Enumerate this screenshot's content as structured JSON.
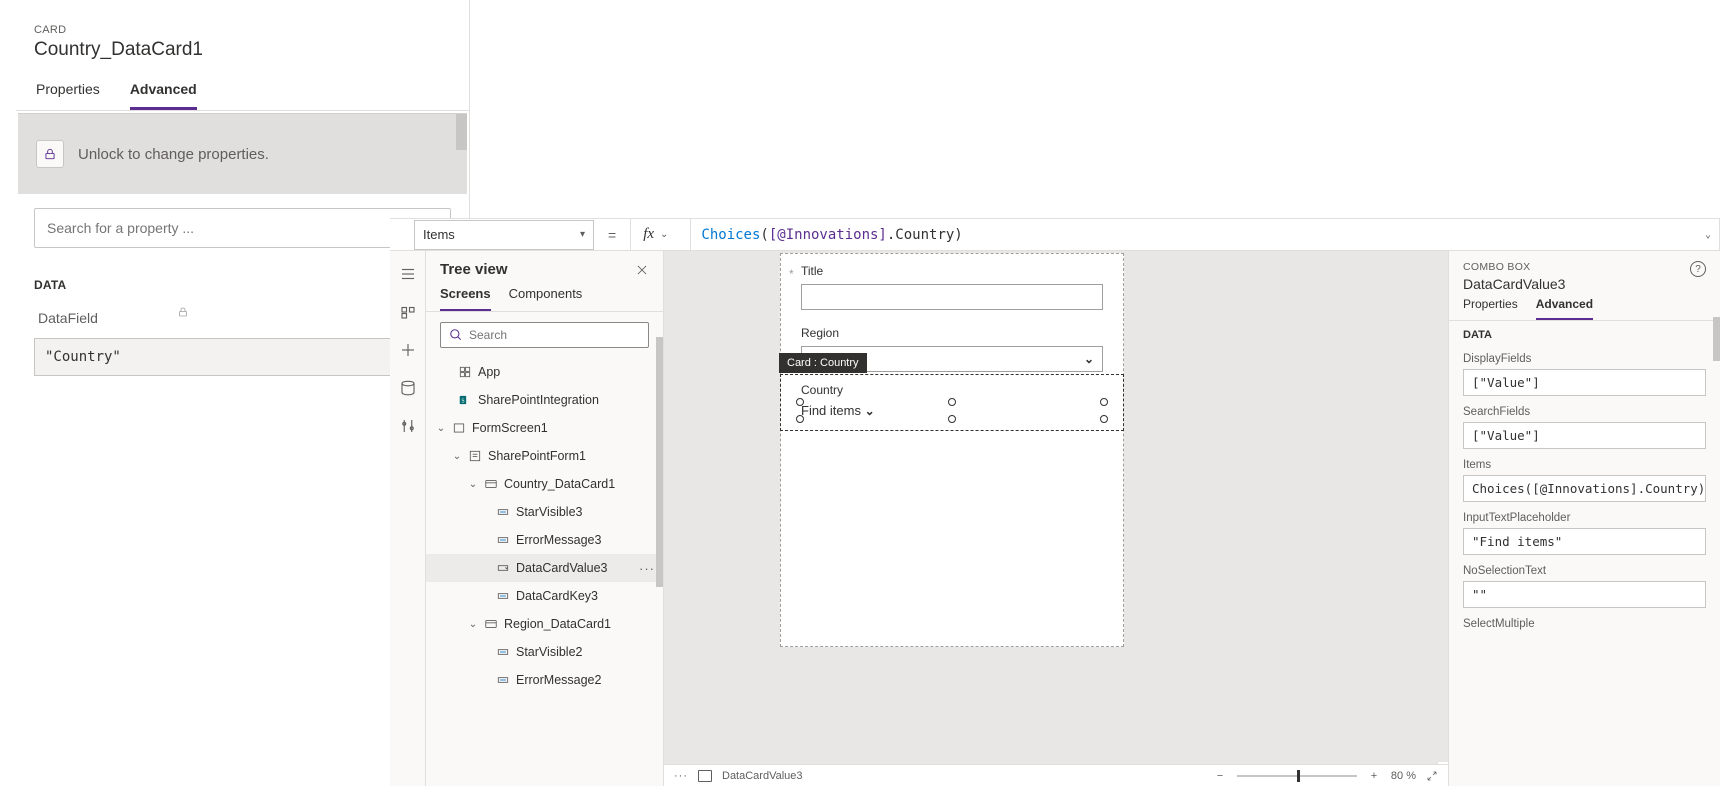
{
  "leftPanel": {
    "typeLabel": "CARD",
    "name": "Country_DataCard1",
    "tabs": {
      "properties": "Properties",
      "advanced": "Advanced"
    },
    "unlockMsg": "Unlock to change properties.",
    "searchPlaceholder": "Search for a property ...",
    "dataSection": "DATA",
    "dataFieldLabel": "DataField",
    "dataFieldValue": "\"Country\""
  },
  "formulaBar": {
    "property": "Items",
    "fx": "fx",
    "formula_fn": "Choices",
    "formula_open": "(",
    "formula_ds": "[@Innovations]",
    "formula_rest": ".Country)"
  },
  "treeView": {
    "title": "Tree view",
    "tabs": {
      "screens": "Screens",
      "components": "Components"
    },
    "searchPlaceholder": "Search",
    "nodes": {
      "app": "App",
      "sharepoint": "SharePointIntegration",
      "formscreen": "FormScreen1",
      "spform": "SharePointForm1",
      "countryCard": "Country_DataCard1",
      "starVisible3": "StarVisible3",
      "errorMessage3": "ErrorMessage3",
      "dataCardValue3": "DataCardValue3",
      "dataCardKey3": "DataCardKey3",
      "regionCard": "Region_DataCard1",
      "starVisible2": "StarVisible2",
      "errorMessage2": "ErrorMessage2"
    },
    "ellipsis": "···"
  },
  "canvas": {
    "titleLabel": "Title",
    "regionLabel": "Region",
    "countryLabel": "Country",
    "tooltip": "Card : Country",
    "findItems": "Find items",
    "breadcrumb": "DataCardValue3",
    "zoomMinus": "−",
    "zoomPlus": "+",
    "zoom": "80 %"
  },
  "rightPanel": {
    "typeLabel": "COMBO BOX",
    "name": "DataCardValue3",
    "tabs": {
      "properties": "Properties",
      "advanced": "Advanced"
    },
    "dataSection": "DATA",
    "displayFieldsLabel": "DisplayFields",
    "displayFieldsValue": "[\"Value\"]",
    "searchFieldsLabel": "SearchFields",
    "searchFieldsValue": "[\"Value\"]",
    "itemsLabel": "Items",
    "itemsValue": "Choices([@Innovations].Country)",
    "inputTextLabel": "InputTextPlaceholder",
    "inputTextValue": "\"Find items\"",
    "noSelLabel": "NoSelectionText",
    "noSelValue": "\"\"",
    "selectMultipleLabel": "SelectMultiple"
  }
}
